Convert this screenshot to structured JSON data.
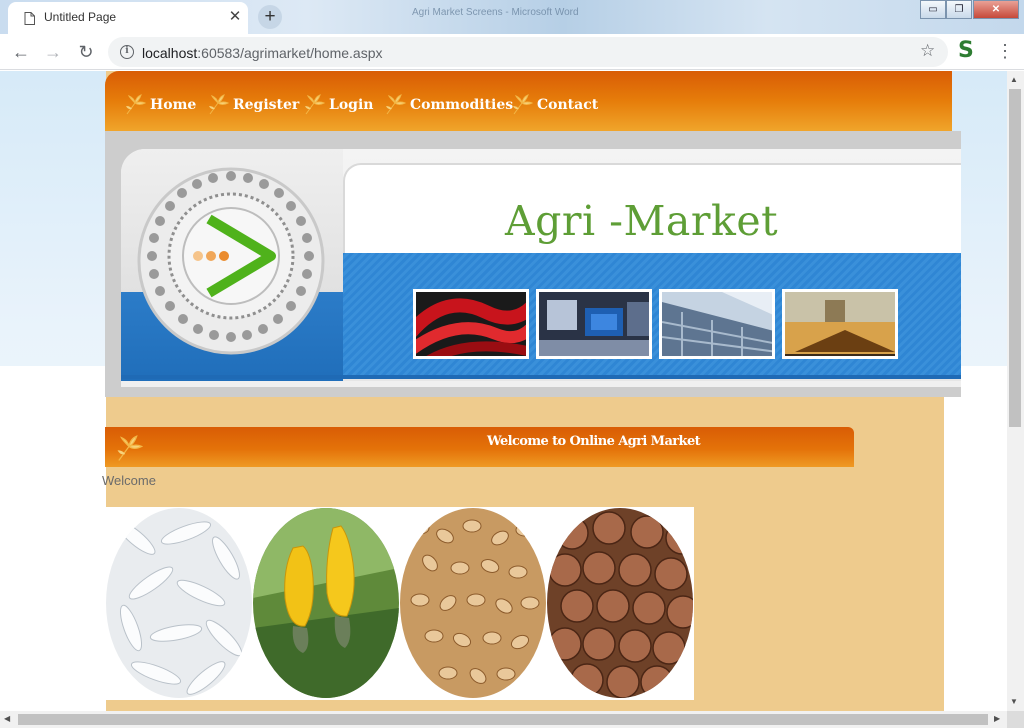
{
  "browser": {
    "tab_title": "Untitled Page",
    "tab_close": "✕",
    "new_tab": "+",
    "window_title": "Agri Market Screens - Microsoft Word",
    "minimize": "▭",
    "maximize": "❐",
    "close": "✕",
    "back": "←",
    "forward": "→",
    "reload": "↻",
    "url_host": "localhost",
    "url_rest": ":60583/agrimarket/home.aspx",
    "info": "i",
    "star": "☆",
    "extension": "S",
    "menu": "⋮"
  },
  "site": {
    "nav": [
      "Home",
      "Register",
      "Login",
      "Commodities",
      "Contact"
    ],
    "title": "Agri -Market",
    "welcome_title": "Welcome to Online Agri Market",
    "welcome_text": "Welcome"
  },
  "scrollbar": {
    "up": "▲",
    "down": "▼",
    "left": "◀",
    "right": "▶"
  },
  "colors": {
    "nav_orange": "#e67d0a",
    "title_green": "#5e9e36",
    "content_tan": "#eecb8d",
    "banner_blue": "#2f86d4"
  }
}
